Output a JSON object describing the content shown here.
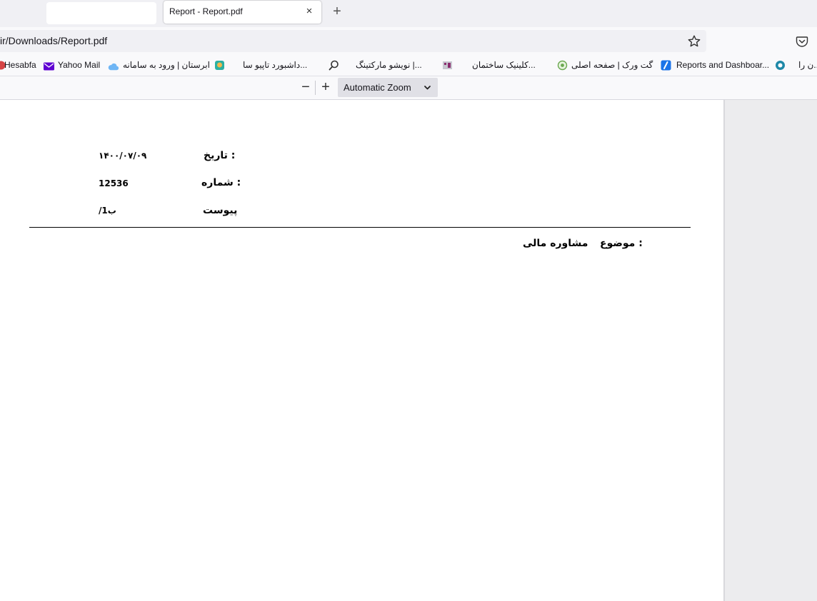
{
  "tabs": [
    {
      "title": ""
    },
    {
      "title": "Report - Report.pdf",
      "close": "×"
    }
  ],
  "new_tab": "+",
  "url": "ir/Downloads/Report.pdf",
  "bookmarks": [
    {
      "label": "Hesabfa"
    },
    {
      "label": "Yahoo Mail"
    },
    {
      "label": "ابرستان | ورود به سامانه"
    },
    {
      "label": "داشبورد تاپیو سا..."
    },
    {
      "label": "نویشو مارکتینگ |..."
    },
    {
      "label": "کلینیک ساختمان..."
    },
    {
      "label": "گت ورک | صفحه اصلی"
    },
    {
      "label": "Reports and Dashboar..."
    },
    {
      "label": "ن را..."
    }
  ],
  "pdf_toolbar": {
    "zoom_out": "−",
    "zoom_in": "+",
    "zoom_value": "Automatic Zoom"
  },
  "document": {
    "date_label": "تاریخ :",
    "date_value": "۱۴۰۰/۰۷/۰۹",
    "number_label": "شماره :",
    "number_value": "12536",
    "attachment_label": "پیوست",
    "attachment_value": "/1ب",
    "subject_label": "موضوع :",
    "subject_value": "مشاوره مالی"
  },
  "colors": {
    "chrome": "#f0f0f4",
    "toolbar": "#f9f9fb",
    "page": "#ffffff",
    "yahoo_purple": "#6001d2",
    "reports_blue": "#1a73e8"
  }
}
